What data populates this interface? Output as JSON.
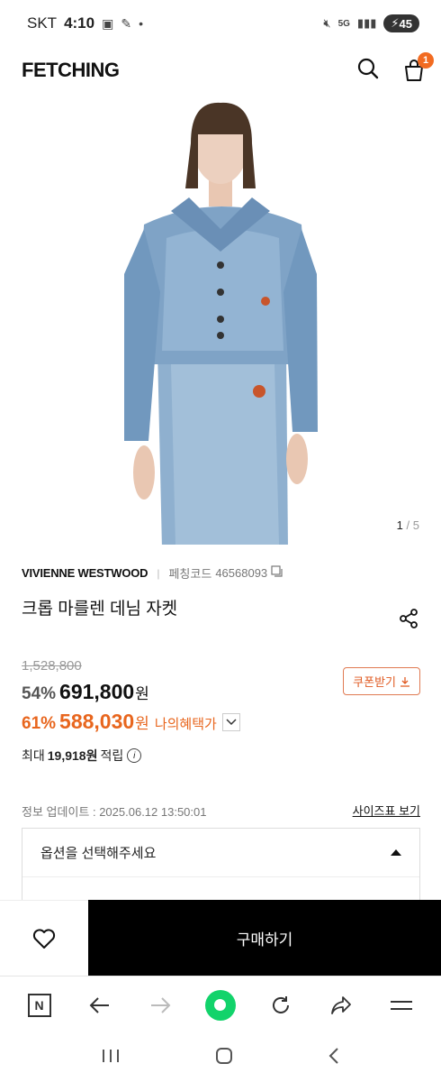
{
  "status_bar": {
    "carrier": "SKT",
    "time": "4:10",
    "battery": "45"
  },
  "header": {
    "logo": "FETCHING",
    "cart_count": "1"
  },
  "gallery": {
    "current": "1",
    "separator": "/",
    "total": "5"
  },
  "product": {
    "brand": "VIVIENNE WESTWOOD",
    "code_label": "페칭코드",
    "code": "46568093",
    "title": "크롭 마를렌 데님 자켓",
    "original_price": "1,528,800",
    "discount": "54%",
    "price": "691,800",
    "currency": "원",
    "coupon_label": "쿠폰받기",
    "my_discount": "61%",
    "my_price": "588,030",
    "my_benefit_label": "나의혜택가",
    "points_prefix": "최대",
    "points": "19,918원",
    "points_suffix": "적립",
    "update_info": "정보 업데이트 : 2025.06.12 13:50:01",
    "size_guide": "사이즈표 보기",
    "option_placeholder": "옵션을 선택해주세요"
  },
  "buy_bar": {
    "buy_label": "구매하기"
  },
  "colors": {
    "accent": "#f26b21",
    "my_price": "#e8661e",
    "buy_button": "#000000",
    "browser_green": "#12d36b"
  }
}
